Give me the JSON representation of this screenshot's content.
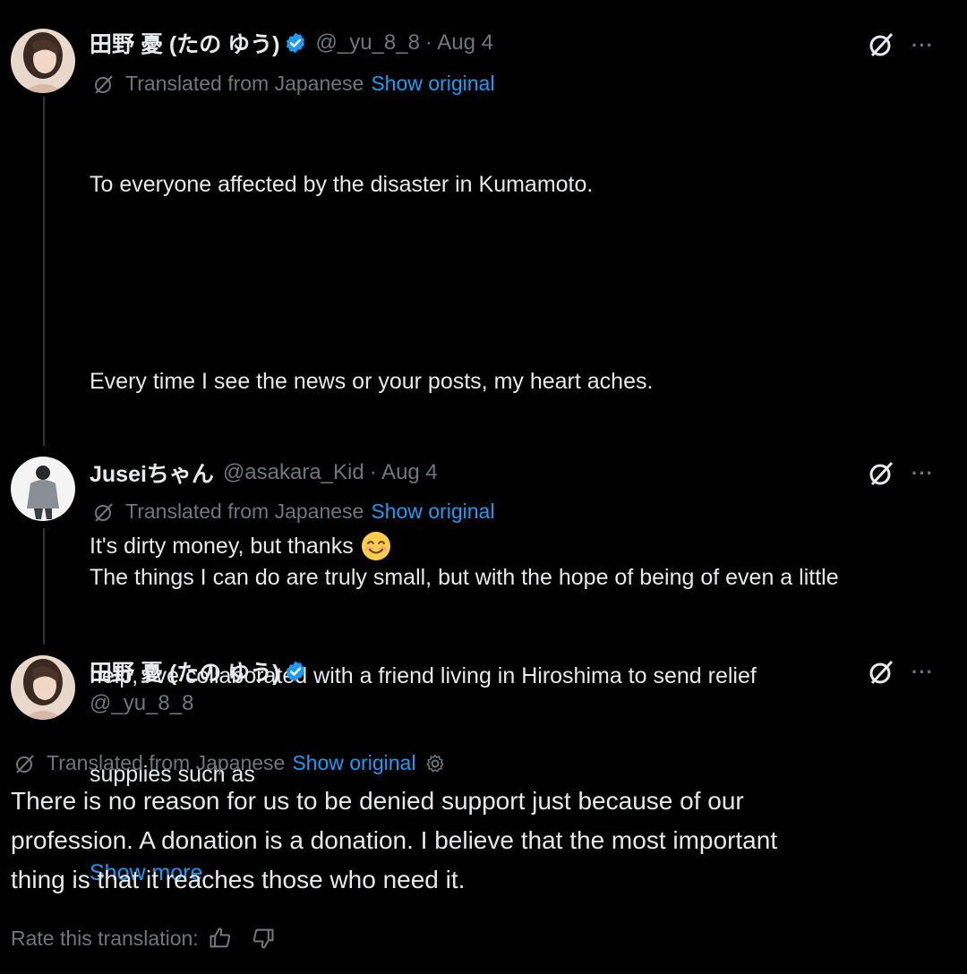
{
  "colors": {
    "background": "#000000",
    "text": "#e7e9ea",
    "muted": "#71767b",
    "link": "#1d9bf0",
    "verified": "#1d9bf0",
    "thread_line": "#333639"
  },
  "tweet1": {
    "name": "田野 憂 (たの ゆう)",
    "handle": "@_yu_8_8",
    "date": "· Aug 4",
    "translated_label": "Translated from Japanese",
    "show_original": "Show original",
    "para1": "To everyone affected by the disaster in Kumamoto.",
    "para2": "Every time I see the news or your posts, my heart aches.",
    "para3_line1": "The things I can do are truly small, but with the hope of being of even a little",
    "para3_line2": "help, I’ve collaborated with a friend living in Hiroshima to send relief",
    "para3_line3": "supplies such as",
    "show_more": "Show more",
    "more_label": "···"
  },
  "tweet2": {
    "name": "Juseiちゃん",
    "handle": "@asakara_Kid",
    "date": "· Aug 4",
    "translated_label": "Translated from Japanese",
    "show_original": "Show original",
    "text": "It's dirty money, but thanks",
    "more_label": "···"
  },
  "tweet3": {
    "name": "田野 憂 (たの ゆう)",
    "handle": "@_yu_8_8",
    "translated_label": "Translated from Japanese",
    "show_original": "Show original",
    "line1": "There is no reason for us to be denied support just because of our",
    "line2": "profession. A donation is a donation. I believe that the most important",
    "line3": "thing is that it reaches those who need it.",
    "rate_label": "Rate this translation:",
    "more_label": "···"
  },
  "icons": [
    "grok-icon",
    "more-icon",
    "verified-icon",
    "translate-icon",
    "gear-icon",
    "thumbs-up-icon",
    "thumbs-down-icon",
    "smile-emoji-icon"
  ]
}
